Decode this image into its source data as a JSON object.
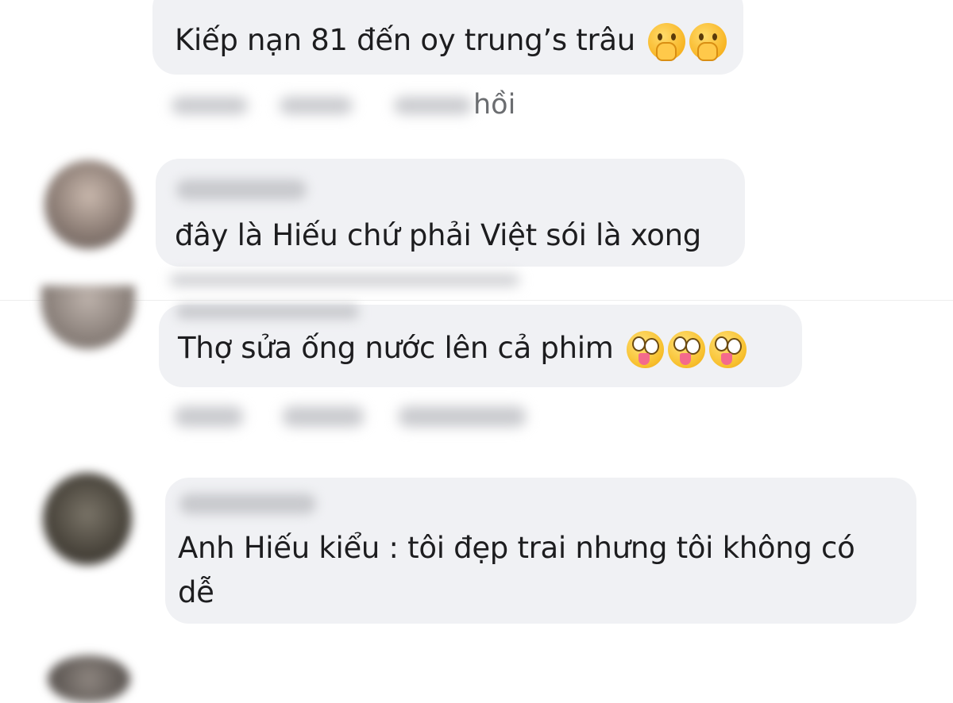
{
  "comments": [
    {
      "text": "Kiếp nạn 81 đến oy trung’s trâu",
      "emoji": [
        "hand-over-mouth-emoji",
        "hand-over-mouth-emoji"
      ]
    },
    {
      "text": "đây là Hiếu chứ phải Việt sói là xong",
      "emoji": []
    },
    {
      "text": "Thợ sửa ống nước lên cả phim",
      "emoji": [
        "zany-face-emoji",
        "zany-face-emoji",
        "zany-face-emoji"
      ]
    },
    {
      "text_line1": "Anh Hiếu kiểu : tôi đẹp trai nhưng tôi không có",
      "text_line2": "dễ",
      "emoji": []
    }
  ],
  "meta_visible": {
    "reply_partial": "hồi"
  },
  "colors": {
    "bubble": "#f0f1f4",
    "text": "#1d1d1f",
    "meta": "#6b6d70",
    "background": "#ffffff"
  }
}
